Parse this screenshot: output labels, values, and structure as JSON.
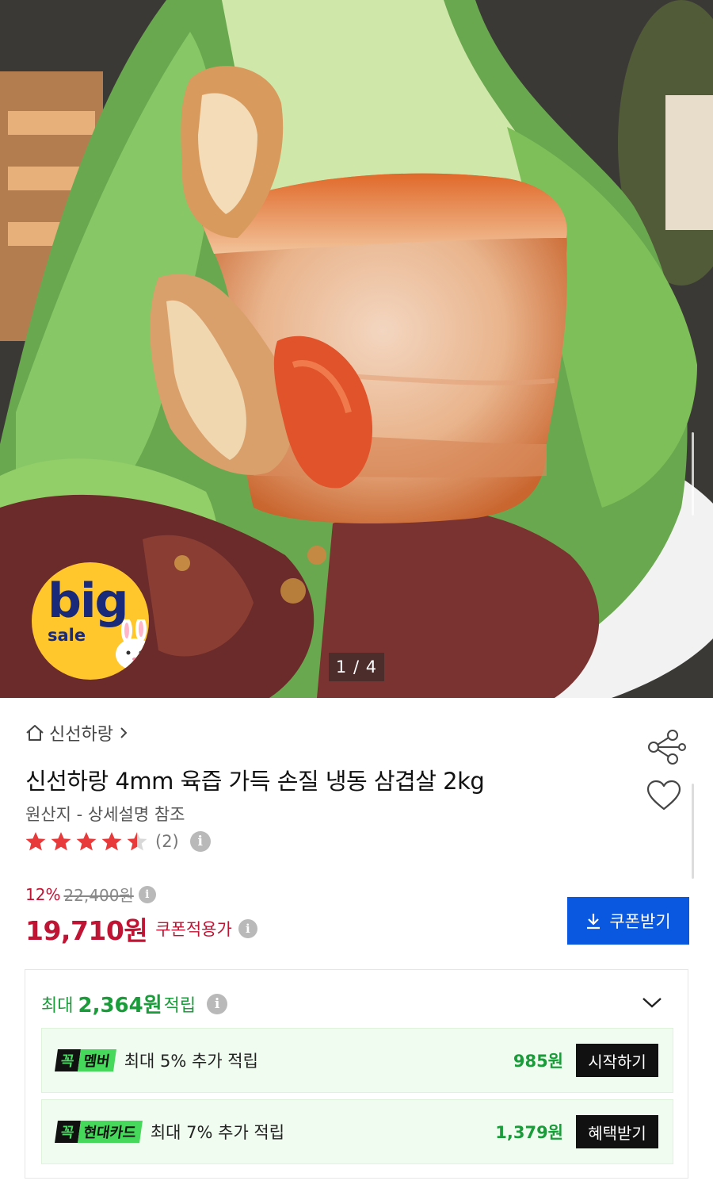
{
  "hero": {
    "counter": "1 / 4",
    "badge": {
      "big": "big",
      "sale": "sale"
    }
  },
  "product": {
    "store": "신선하랑",
    "title": "신선하랑 4mm 육즙 가득 손질 냉동 삼겹살 2kg",
    "origin": "원산지 - 상세설명 참조",
    "rating_value": 4.5,
    "rating_count": "(2)",
    "discount": "12%",
    "original_price": "22,400원",
    "price": "19,710원",
    "coupon_price_label": "쿠폰적용가",
    "coupon_button": "쿠폰받기"
  },
  "points": {
    "prefix": "최대",
    "amount": "2,364원",
    "suffix": "적립",
    "benefits": [
      {
        "tag_k": "꼭",
        "tag_name": "멤버",
        "text": "최대 5% 추가 적립",
        "amount": "985원",
        "button": "시작하기"
      },
      {
        "tag_k": "꼭",
        "tag_name": "현대카드",
        "text": "최대 7% 추가 적립",
        "amount": "1,379원",
        "button": "혜택받기"
      }
    ]
  },
  "colors": {
    "sale_red": "#c01434",
    "coupon_blue": "#0a57e0",
    "point_green": "#1a9c3a",
    "star_red": "#e83a3a"
  },
  "icons": [
    "home-icon",
    "chevron-right-icon",
    "share-icon",
    "heart-icon",
    "star-icon",
    "info-icon",
    "download-icon",
    "chevron-down-icon"
  ]
}
